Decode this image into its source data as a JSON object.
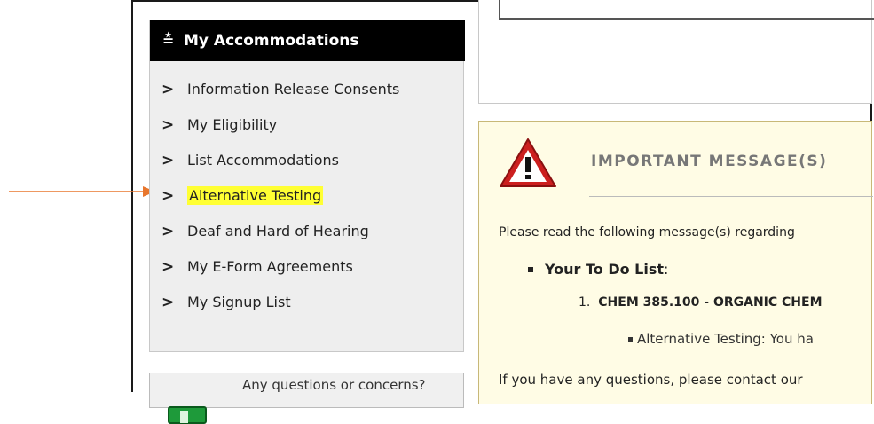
{
  "sidebar": {
    "header": "My Accommodations",
    "items": [
      {
        "label": "Information Release Consents",
        "highlighted": false
      },
      {
        "label": "My Eligibility",
        "highlighted": false
      },
      {
        "label": "List Accommodations",
        "highlighted": false
      },
      {
        "label": "Alternative Testing",
        "highlighted": true
      },
      {
        "label": "Deaf and Hard of Hearing",
        "highlighted": false
      },
      {
        "label": "My E-Form Agreements",
        "highlighted": false
      },
      {
        "label": "My Signup List",
        "highlighted": false
      }
    ]
  },
  "help": {
    "text": "Any questions or concerns?"
  },
  "message": {
    "title": "IMPORTANT MESSAGE(S)",
    "intro": "Please read the following message(s) regarding",
    "todo_label": "Your To Do List",
    "todo_colon": ":",
    "course_number": "1.",
    "course_name": "CHEM 385.100 - ORGANIC CHEM",
    "course_item": "Alternative Testing: You ha",
    "questions": "If you have any questions, please contact our"
  },
  "colors": {
    "highlight": "#ffff33",
    "annotation_arrow": "#e8762d",
    "warning_red": "#cc1f1f",
    "message_bg": "#fffce5"
  },
  "icons": {
    "header": "double-chevron-down-icon",
    "menu": "chevron-right-icon",
    "warning": "warning-triangle-icon",
    "help": "help-icon"
  }
}
